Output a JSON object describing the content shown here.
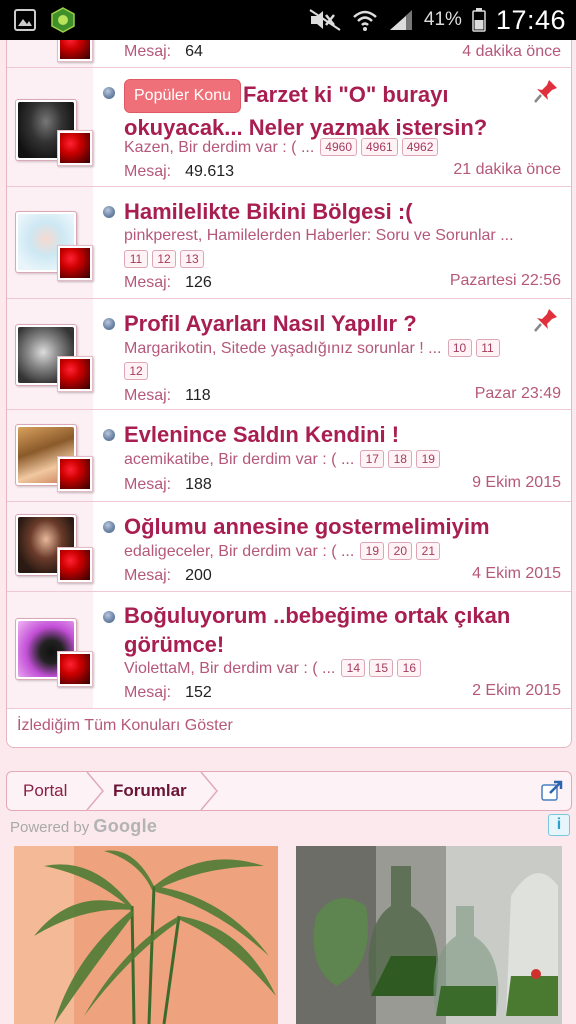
{
  "status_bar": {
    "battery_percent": "41%",
    "time": "17:46"
  },
  "rows": [
    {
      "messages_label": "Mesaj:",
      "messages": "64",
      "time": "4 dakika önce"
    },
    {
      "badge": "Popüler Konu",
      "title": "Farzet ki \"O\" burayı okuyacak... Neler yazmak istersin?",
      "author_forum": "Kazen, Bir derdim var : (",
      "ellipsis": "...",
      "pages": [
        "4960",
        "4961",
        "4962"
      ],
      "messages_label": "Mesaj:",
      "messages": "49.613",
      "time": "21 dakika önce",
      "pinned": true
    },
    {
      "title": "Hamilelikte Bikini Bölgesi :(",
      "author_forum": "pinkperest, Hamilelerden Haberler: Soru ve Sorunlar",
      "ellipsis": "...",
      "pages": [
        "11",
        "12",
        "13"
      ],
      "messages_label": "Mesaj:",
      "messages": "126",
      "time": "Pazartesi 22:56"
    },
    {
      "title": "Profil Ayarları Nasıl Yapılır ?",
      "author_forum": "Margarikotin, Sitede yaşadığınız sorunlar !",
      "ellipsis": "...",
      "pages": [
        "10",
        "11",
        "12"
      ],
      "messages_label": "Mesaj:",
      "messages": "118",
      "time": "Pazar 23:49",
      "pinned": true
    },
    {
      "title": "Evlenince Saldın Kendini !",
      "author_forum": "acemikatibe, Bir derdim var : (",
      "ellipsis": "...",
      "pages": [
        "17",
        "18",
        "19"
      ],
      "messages_label": "Mesaj:",
      "messages": "188",
      "time": "9 Ekim 2015"
    },
    {
      "title": "Oğlumu annesine gostermelimiyim",
      "author_forum": "edaligeceler, Bir derdim var : (",
      "ellipsis": "...",
      "pages": [
        "19",
        "20",
        "21"
      ],
      "messages_label": "Mesaj:",
      "messages": "200",
      "time": "4 Ekim 2015"
    },
    {
      "title": "Boğuluyorum ..bebeğime ortak çıkan görümce!",
      "author_forum": "ViolettaM, Bir derdim var : (",
      "ellipsis": "...",
      "pages": [
        "14",
        "15",
        "16"
      ],
      "messages_label": "Mesaj:",
      "messages": "152",
      "time": "2 Ekim 2015"
    }
  ],
  "watched_link": "İzlediğim Tüm Konuları Göster",
  "breadcrumb": {
    "portal": "Portal",
    "forums": "Forumlar"
  },
  "ads": {
    "powered_by": "Powered by",
    "google": "Google"
  },
  "colors": {
    "accent": "#a81e50",
    "meta": "#b5587a",
    "page_bg": "#fbe9ee",
    "border": "#e8b5c4"
  }
}
